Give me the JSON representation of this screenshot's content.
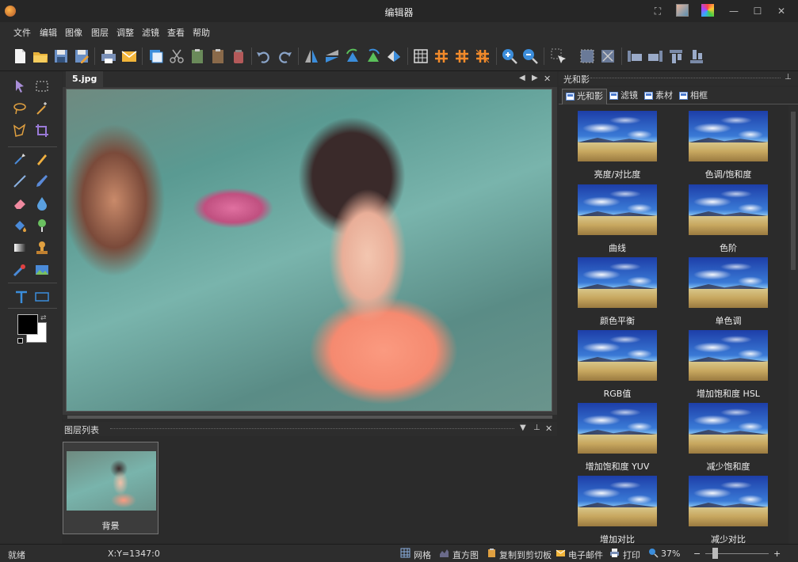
{
  "window": {
    "title": "编辑器",
    "controls": {
      "fullscreen": "⛶",
      "minimize": "—",
      "maximize": "☐",
      "close": "✕"
    }
  },
  "menu": [
    "文件",
    "编辑",
    "图像",
    "图层",
    "调整",
    "滤镜",
    "查看",
    "帮助"
  ],
  "toolbar_icons": [
    "new-file",
    "open-folder",
    "save",
    "save-as",
    "print",
    "email",
    "copy",
    "cut",
    "paste-1",
    "paste-2",
    "paste-3",
    "undo",
    "redo",
    "flip-horizontal",
    "flip-vertical",
    "rotate-left",
    "rotate-right",
    "crop-rotate",
    "grid",
    "hash-1",
    "hash-2",
    "hash-3",
    "zoom-in",
    "zoom-out",
    "pointer",
    "select-1",
    "select-2",
    "align-1",
    "align-2",
    "align-3",
    "align-4"
  ],
  "document": {
    "tab_name": "5.jpg",
    "nav_prev": "◀",
    "nav_next": "▶",
    "close": "✕"
  },
  "layers_panel": {
    "title": "图层列表",
    "layers": [
      {
        "name": "背景"
      }
    ]
  },
  "right_panel": {
    "title": "光和影",
    "tabs": [
      "光和影",
      "滤镜",
      "素材",
      "相框"
    ],
    "active_tab": 0,
    "filters": [
      "亮度/对比度",
      "色调/饱和度",
      "曲线",
      "色阶",
      "颜色平衡",
      "单色调",
      "RGB值",
      "增加饱和度 HSL",
      "增加饱和度 YUV",
      "减少饱和度",
      "增加对比",
      "减少对比"
    ]
  },
  "status": {
    "ready": "就绪",
    "coords": "X:Y=1347:0",
    "grid": "网格",
    "histogram": "直方图",
    "copy_clipboard": "复制到剪切板",
    "email": "电子邮件",
    "print": "打印",
    "zoom": "37%",
    "zoom_minus": "−",
    "zoom_plus": "+"
  },
  "colors": {
    "foreground": "#000000",
    "background": "#ffffff",
    "accent": "#3a7ad6"
  }
}
